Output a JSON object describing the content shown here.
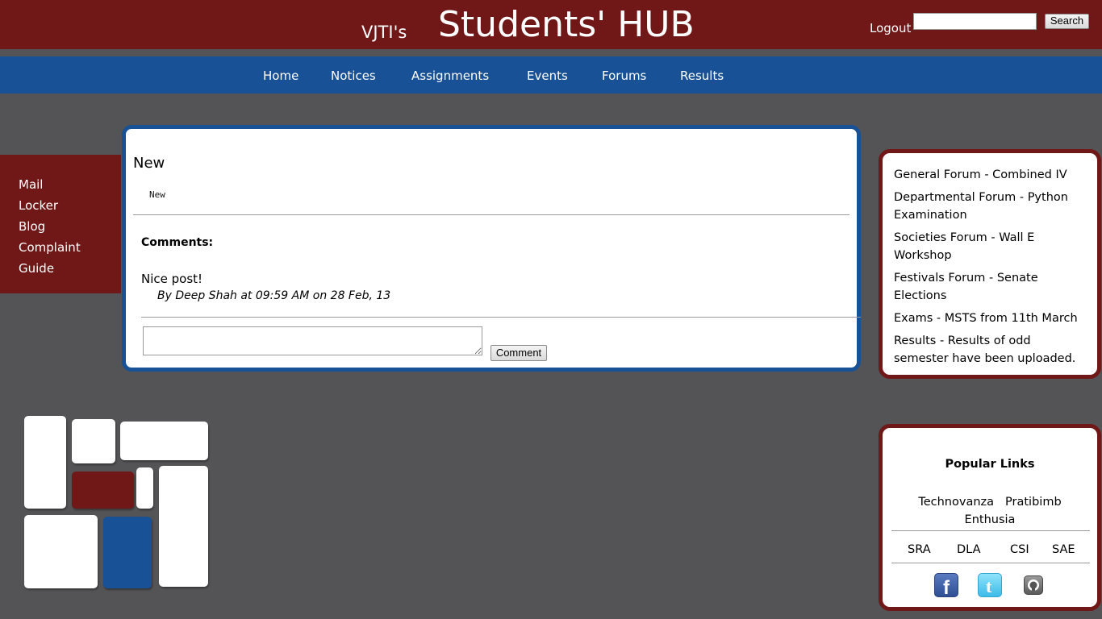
{
  "header": {
    "brand_small": "VJTI's",
    "brand_big": "Students' HUB",
    "logout_label": "Logout",
    "search_placeholder": "",
    "search_button": "Search"
  },
  "nav": {
    "items": [
      "Home",
      "Notices",
      "Assignments",
      "Events",
      "Forums",
      "Results"
    ]
  },
  "sidebar": {
    "links": [
      "Mail",
      "Locker",
      "Blog",
      "Complaint",
      "Guide"
    ]
  },
  "post": {
    "title": "New",
    "body": "New",
    "comments_heading": "Comments:",
    "comments": [
      {
        "text": "Nice post!",
        "meta": "By Deep Shah at 09:59 AM on 28 Feb, 13"
      }
    ],
    "comment_placeholder": "",
    "comment_button": "Comment"
  },
  "forums": {
    "items": [
      "General Forum - Combined IV",
      "Departmental Forum - Python Examination",
      "Societies Forum - Wall E Workshop",
      "Festivals Forum - Senate Elections",
      "Exams - MSTS from 11th March",
      "Results - Results of odd semester have been uploaded."
    ]
  },
  "popular_links": {
    "title": "Popular Links",
    "fests": [
      "Technovanza",
      "Pratibimb",
      "Enthusia"
    ],
    "clubs": [
      "SRA",
      "DLA",
      "CSI",
      "SAE"
    ],
    "social": [
      {
        "icon": "facebook-icon",
        "color": "#3b5998"
      },
      {
        "icon": "twitter-icon",
        "color": "#33ccff"
      },
      {
        "icon": "github-icon",
        "color": "#555555"
      }
    ]
  },
  "colors": {
    "maroon": "#701717",
    "blue": "#185195",
    "background": "#545456"
  }
}
